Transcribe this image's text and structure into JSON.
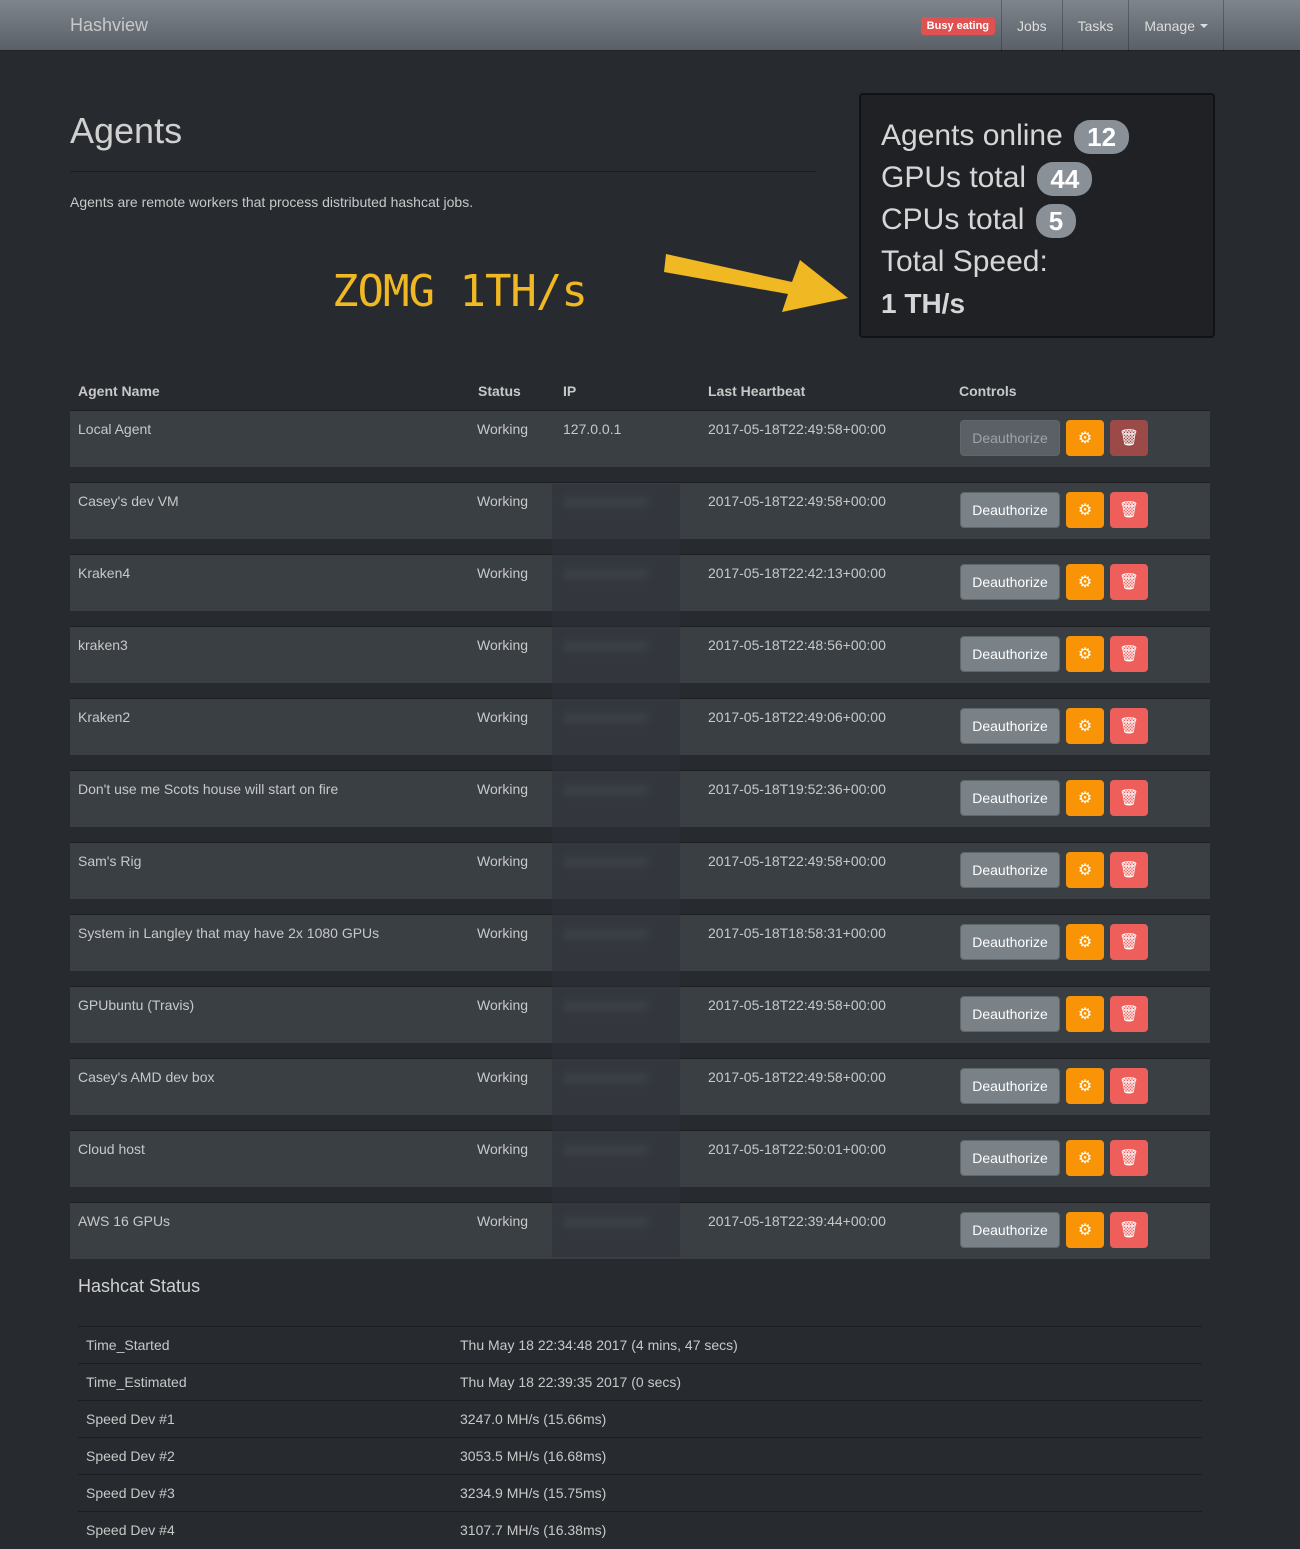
{
  "navbar": {
    "brand": "Hashview",
    "busy_badge": "Busy eating",
    "items": [
      "Jobs",
      "Tasks",
      "Manage"
    ]
  },
  "header": {
    "title": "Agents",
    "description": "Agents are remote workers that process distributed hashcat jobs."
  },
  "annotation": {
    "text": "ZOMG 1TH/s",
    "color": "#f0b822"
  },
  "stats": {
    "agents_online_label": "Agents online",
    "agents_online": "12",
    "gpus_total_label": "GPUs total",
    "gpus_total": "44",
    "cpus_total_label": "CPUs total",
    "cpus_total": "5",
    "total_speed_label": "Total Speed:",
    "total_speed": "1 TH/s"
  },
  "table": {
    "headers": [
      "Agent Name",
      "Status",
      "IP",
      "Last Heartbeat",
      "Controls"
    ],
    "deauthorize_label": "Deauthorize",
    "rows": [
      {
        "name": "Local Agent",
        "status": "Working",
        "ip": "127.0.0.1",
        "heartbeat": "2017-05-18T22:49:58+00:00"
      },
      {
        "name": "Casey's dev VM",
        "status": "Working",
        "ip": "",
        "heartbeat": "2017-05-18T22:49:58+00:00"
      },
      {
        "name": "Kraken4",
        "status": "Working",
        "ip": "",
        "heartbeat": "2017-05-18T22:42:13+00:00"
      },
      {
        "name": "kraken3",
        "status": "Working",
        "ip": "",
        "heartbeat": "2017-05-18T22:48:56+00:00"
      },
      {
        "name": "Kraken2",
        "status": "Working",
        "ip": "",
        "heartbeat": "2017-05-18T22:49:06+00:00"
      },
      {
        "name": "Don't use me Scots house will start on fire",
        "status": "Working",
        "ip": "",
        "heartbeat": "2017-05-18T19:52:36+00:00"
      },
      {
        "name": "Sam's Rig",
        "status": "Working",
        "ip": "",
        "heartbeat": "2017-05-18T22:49:58+00:00"
      },
      {
        "name": "System in Langley that may have 2x 1080 GPUs",
        "status": "Working",
        "ip": "",
        "heartbeat": "2017-05-18T18:58:31+00:00"
      },
      {
        "name": "GPUbuntu (Travis)",
        "status": "Working",
        "ip": "",
        "heartbeat": "2017-05-18T22:49:58+00:00"
      },
      {
        "name": "Casey's AMD dev box",
        "status": "Working",
        "ip": "",
        "heartbeat": "2017-05-18T22:49:58+00:00"
      },
      {
        "name": "Cloud host",
        "status": "Working",
        "ip": "",
        "heartbeat": "2017-05-18T22:50:01+00:00"
      },
      {
        "name": "AWS 16 GPUs",
        "status": "Working",
        "ip": "",
        "heartbeat": "2017-05-18T22:39:44+00:00"
      }
    ]
  },
  "hashcat_status": {
    "title": "Hashcat Status",
    "rows": [
      {
        "key": "Time_Started",
        "value": "Thu May 18 22:34:48 2017 (4 mins, 47 secs)"
      },
      {
        "key": "Time_Estimated",
        "value": "Thu May 18 22:39:35 2017 (0 secs)"
      },
      {
        "key": "Speed Dev #1",
        "value": "3247.0 MH/s (15.66ms)"
      },
      {
        "key": "Speed Dev #2",
        "value": "3053.5 MH/s (16.68ms)"
      },
      {
        "key": "Speed Dev #3",
        "value": "3234.9 MH/s (15.75ms)"
      },
      {
        "key": "Speed Dev #4",
        "value": "3107.7 MH/s (16.38ms)"
      }
    ]
  }
}
